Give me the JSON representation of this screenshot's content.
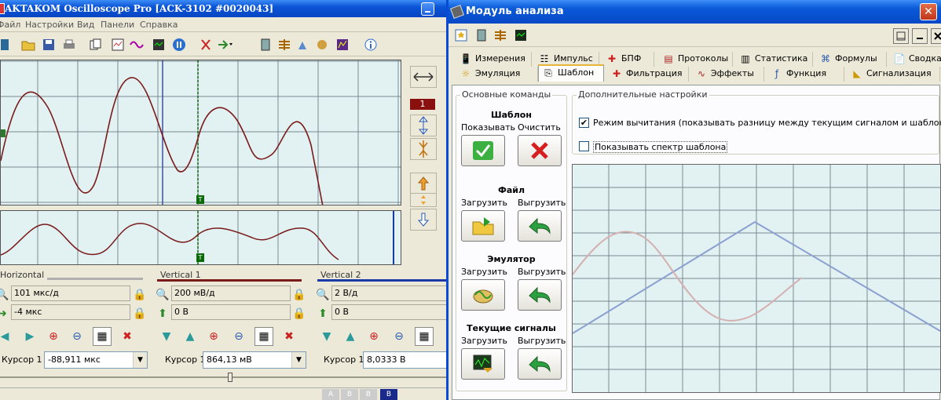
{
  "main_window": {
    "title": "AKTAKOM Oscilloscope Pro [ACK-3102 #0020043]",
    "menu": [
      "Файл",
      "Настройки",
      "Вид",
      "Панели",
      "Справка"
    ],
    "panels": {
      "horizontal": {
        "title": "Horizontal",
        "timebase": "101 мкс/д",
        "offset": "-4 мкс",
        "cursor_label": "Курсор 1",
        "cursor_value": "-88,911 мкс"
      },
      "vertical1": {
        "title": "Vertical 1",
        "scale": "200 мВ/д",
        "offset": "0 В",
        "cursor_label": "Курсор 1",
        "cursor_value": "864,13 мВ"
      },
      "vertical2": {
        "title": "Vertical 2",
        "scale": "2 В/д",
        "offset": "0 В",
        "cursor_label": "Курсор 1",
        "cursor_value": "8,0333 В"
      }
    },
    "channel_badge": "1",
    "trigger_marker": "T",
    "status_tabs": [
      "A",
      "B",
      "B"
    ],
    "colors": {
      "ch1": "#7a1a1a",
      "ch2": "#1a3aa8",
      "grid_bg": "#e2f1f1"
    }
  },
  "analysis": {
    "title": "Модуль анализа",
    "tabs_row1": [
      "Измерения",
      "Импульс",
      "БПФ",
      "Протоколы",
      "Статистика",
      "Формулы",
      "Сводка"
    ],
    "tabs_row2": [
      "Эмуляция",
      "Шаблон",
      "Фильтрация",
      "Эффекты",
      "Функция",
      "Сигнализация"
    ],
    "active_tab": "Шаблон",
    "basic": {
      "title": "Основные команды",
      "template": {
        "header": "Шаблон",
        "show": "Показывать",
        "clear": "Очистить"
      },
      "file": {
        "header": "Файл",
        "load": "Загрузить",
        "unload": "Выгрузить"
      },
      "emulator": {
        "header": "Эмулятор",
        "load": "Загрузить",
        "unload": "Выгрузить"
      },
      "current": {
        "header": "Текущие сигналы",
        "load": "Загрузить",
        "unload": "Выгрузить"
      }
    },
    "extra": {
      "title": "Дополнительные настройки",
      "subtract_mode": {
        "label": "Режим вычитания (показывать разницу между текущим сигналом и шаблоном)",
        "checked": true
      },
      "show_spectrum": {
        "label": "Показывать спектр шаблона",
        "checked": false
      }
    }
  }
}
